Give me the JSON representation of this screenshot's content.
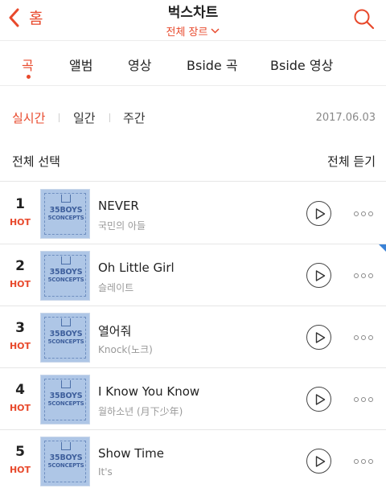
{
  "header": {
    "back_label": "홈",
    "title": "벅스차트",
    "genre_label": "전체 장르"
  },
  "tabs": [
    {
      "label": "곡",
      "active": true
    },
    {
      "label": "앨범",
      "active": false
    },
    {
      "label": "영상",
      "active": false
    },
    {
      "label": "Bside 곡",
      "active": false
    },
    {
      "label": "Bside 영상",
      "active": false
    }
  ],
  "period": {
    "items": [
      {
        "label": "실시간",
        "active": true
      },
      {
        "label": "일간",
        "active": false
      },
      {
        "label": "주간",
        "active": false
      }
    ],
    "date": "2017.06.03"
  },
  "list": {
    "select_all": "전체 선택",
    "listen_all": "전체 듣기"
  },
  "album_art": {
    "line1": "35BOYS",
    "line2": "5CONCEPTS"
  },
  "colors": {
    "accent": "#e8492c",
    "new_marker": "#3b82d6"
  },
  "songs": [
    {
      "rank": "1",
      "badge": "HOT",
      "title": "NEVER",
      "artist": "국민의 아들"
    },
    {
      "rank": "2",
      "badge": "HOT",
      "title": "Oh Little Girl",
      "artist": "슬레이트"
    },
    {
      "rank": "3",
      "badge": "HOT",
      "title": "열어줘",
      "artist": "Knock(노크)"
    },
    {
      "rank": "4",
      "badge": "HOT",
      "title": "I Know You Know",
      "artist": "월하소년 (月下少年)"
    },
    {
      "rank": "5",
      "badge": "HOT",
      "title": "Show Time",
      "artist": "It's"
    }
  ]
}
